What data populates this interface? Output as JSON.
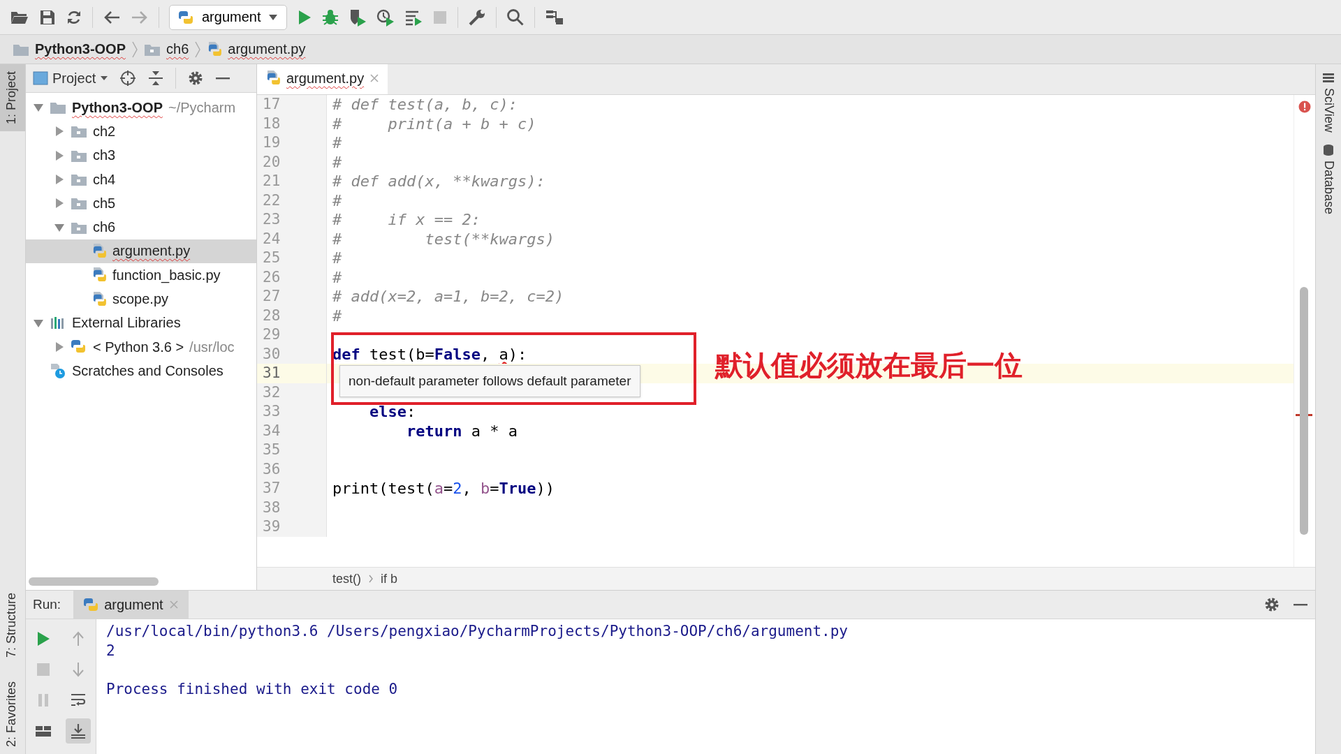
{
  "toolbar": {
    "run_config": "argument",
    "stop": {
      "disabled": true
    }
  },
  "navbar": {
    "breadcrumbs": [
      {
        "kind": "project-folder",
        "label": "Python3-OOP"
      },
      {
        "kind": "folder",
        "label": "ch6"
      },
      {
        "kind": "python-file",
        "label": "argument.py"
      }
    ]
  },
  "left_strip": {
    "top": [
      {
        "label": "1: Project",
        "selected": true
      }
    ],
    "bottom": [
      {
        "label": "7: Structure",
        "selected": false
      },
      {
        "label": "2: Favorites",
        "selected": false
      }
    ]
  },
  "right_strip": [
    {
      "kind": "sciview",
      "label": "SciView"
    },
    {
      "kind": "database",
      "label": "Database"
    }
  ],
  "project_panel": {
    "title": "Project",
    "tree": [
      {
        "kind": "project-folder",
        "label": "Python3-OOP",
        "suffix": "~/Pycharm",
        "expanded": true,
        "selected": false,
        "children": [
          {
            "kind": "folder",
            "label": "ch2",
            "expanded": false,
            "selected": false
          },
          {
            "kind": "folder",
            "label": "ch3",
            "expanded": false,
            "selected": false
          },
          {
            "kind": "folder",
            "label": "ch4",
            "expanded": false,
            "selected": false
          },
          {
            "kind": "folder",
            "label": "ch5",
            "expanded": false,
            "selected": false
          },
          {
            "kind": "folder",
            "label": "ch6",
            "expanded": true,
            "selected": false,
            "children": [
              {
                "kind": "python-file",
                "label": "argument.py",
                "selected": true
              },
              {
                "kind": "python-file",
                "label": "function_basic.py",
                "selected": false
              },
              {
                "kind": "python-file",
                "label": "scope.py",
                "selected": false
              }
            ]
          }
        ]
      },
      {
        "kind": "libraries",
        "label": "External Libraries",
        "expanded": true,
        "selected": false,
        "children": [
          {
            "kind": "python-sdk",
            "label": "< Python 3.6 >",
            "suffix": "/usr/loc",
            "expanded": false,
            "selected": false
          }
        ]
      },
      {
        "kind": "scratches",
        "label": "Scratches and Consoles",
        "selected": false
      }
    ]
  },
  "editor": {
    "tabs": [
      {
        "label": "argument.py",
        "selected": true
      }
    ],
    "has_errors": true,
    "lines": [
      {
        "number": "17",
        "current": false,
        "segments": [
          {
            "kind": "comment",
            "text": "# def test(a, b, c):"
          }
        ]
      },
      {
        "number": "18",
        "current": false,
        "segments": [
          {
            "kind": "comment",
            "text": "#     print(a + b + c)"
          }
        ]
      },
      {
        "number": "19",
        "current": false,
        "segments": [
          {
            "kind": "comment",
            "text": "#"
          }
        ]
      },
      {
        "number": "20",
        "current": false,
        "segments": [
          {
            "kind": "comment",
            "text": "#"
          }
        ]
      },
      {
        "number": "21",
        "current": false,
        "segments": [
          {
            "kind": "comment",
            "text": "# def add(x, **kwargs):"
          }
        ]
      },
      {
        "number": "22",
        "current": false,
        "segments": [
          {
            "kind": "comment",
            "text": "#"
          }
        ]
      },
      {
        "number": "23",
        "current": false,
        "segments": [
          {
            "kind": "comment",
            "text": "#     if x == 2:"
          }
        ]
      },
      {
        "number": "24",
        "current": false,
        "segments": [
          {
            "kind": "comment",
            "text": "#         test(**kwargs)"
          }
        ]
      },
      {
        "number": "25",
        "current": false,
        "segments": [
          {
            "kind": "comment",
            "text": "#"
          }
        ]
      },
      {
        "number": "26",
        "current": false,
        "segments": [
          {
            "kind": "comment",
            "text": "#"
          }
        ]
      },
      {
        "number": "27",
        "current": false,
        "segments": [
          {
            "kind": "comment",
            "text": "# add(x=2, a=1, b=2, c=2)"
          }
        ]
      },
      {
        "number": "28",
        "current": false,
        "segments": [
          {
            "kind": "comment",
            "text": "#"
          }
        ]
      },
      {
        "number": "29",
        "current": false
      },
      {
        "number": "30",
        "current": false,
        "segments": [
          {
            "kind": "keyword",
            "text": "def"
          },
          {
            "kind": "plain",
            "text": " test(b="
          },
          {
            "kind": "keyword",
            "text": "False"
          },
          {
            "kind": "plain",
            "text": ", "
          },
          {
            "kind": "error",
            "text": "a"
          },
          {
            "kind": "plain",
            "text": "):"
          }
        ]
      },
      {
        "number": "31",
        "current": true
      },
      {
        "number": "32",
        "current": false
      },
      {
        "number": "33",
        "current": false,
        "segments": [
          {
            "kind": "keyword",
            "text": "    else"
          },
          {
            "kind": "plain",
            "text": ":"
          }
        ]
      },
      {
        "number": "34",
        "current": false,
        "segments": [
          {
            "kind": "keyword",
            "text": "        return"
          },
          {
            "kind": "plain",
            "text": " a * a"
          }
        ]
      },
      {
        "number": "35",
        "current": false
      },
      {
        "number": "36",
        "current": false
      },
      {
        "number": "37",
        "current": false,
        "segments": [
          {
            "kind": "plain",
            "text": "print(test("
          },
          {
            "kind": "param",
            "text": "a"
          },
          {
            "kind": "plain",
            "text": "="
          },
          {
            "kind": "number",
            "text": "2"
          },
          {
            "kind": "plain",
            "text": ", "
          },
          {
            "kind": "param",
            "text": "b"
          },
          {
            "kind": "plain",
            "text": "="
          },
          {
            "kind": "keyword",
            "text": "True"
          },
          {
            "kind": "plain",
            "text": "))"
          }
        ]
      },
      {
        "number": "38",
        "current": false
      },
      {
        "number": "39",
        "current": false
      }
    ],
    "tooltip": {
      "text": "non-default parameter follows default parameter"
    },
    "annotation": {
      "text": "默认值必须放在最后一位"
    },
    "breadcrumb": [
      "test()",
      "if b"
    ]
  },
  "run_panel": {
    "label": "Run:",
    "tabs": [
      {
        "label": "argument",
        "selected": true
      }
    ],
    "stop": {
      "disabled": true
    },
    "scroll_to_end": {
      "on": true
    },
    "console": [
      {
        "kind": "output",
        "text": "/usr/local/bin/python3.6 /Users/pengxiao/PycharmProjects/Python3-OOP/ch6/argument.py"
      },
      {
        "kind": "output",
        "text": "2"
      },
      {
        "kind": "status",
        "text": "Process finished with exit code 0"
      }
    ]
  }
}
